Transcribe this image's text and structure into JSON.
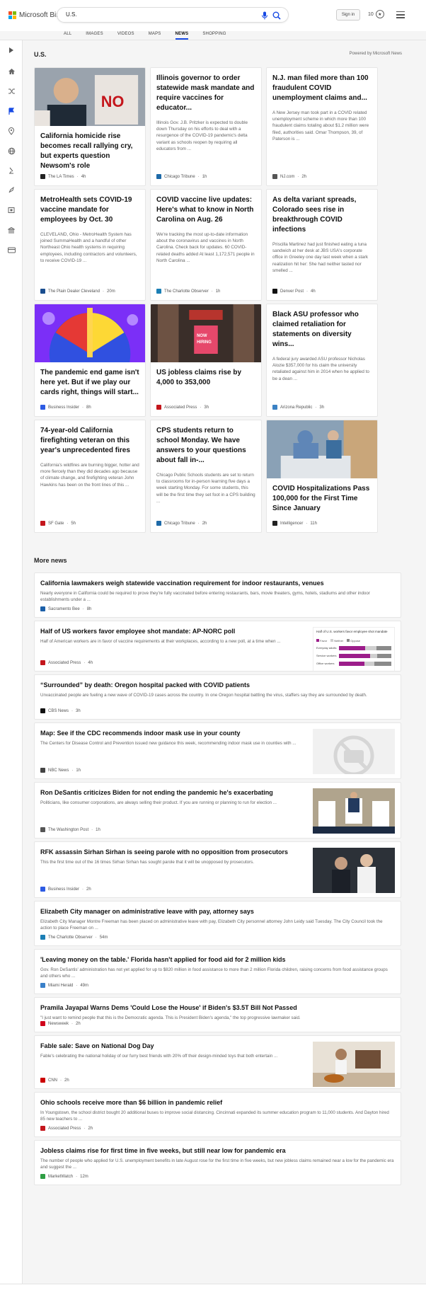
{
  "header": {
    "brand": "Microsoft Bing",
    "query": "U.S.",
    "signin_label": "Sign in",
    "reward_points": "10"
  },
  "tabs": [
    {
      "label": "ALL"
    },
    {
      "label": "IMAGES"
    },
    {
      "label": "VIDEOS"
    },
    {
      "label": "MAPS"
    },
    {
      "label": "NEWS"
    },
    {
      "label": "SHOPPING"
    }
  ],
  "active_tab": "NEWS",
  "colors": {
    "accent": "#174ae4"
  },
  "sidebar_icons": [
    "expand-icon",
    "home-icon",
    "shuffle-icon",
    "flag-icon",
    "location-icon",
    "globe-icon",
    "science-icon",
    "rocket-icon",
    "film-icon",
    "bank-icon",
    "card-icon"
  ],
  "section": {
    "title": "U.S.",
    "powered": "Powered by Microsoft News"
  },
  "cards": [
    {
      "title": "California homicide rise becomes recall rallying cry, but experts question Newsom's role",
      "snippet": "",
      "source": "The LA Times",
      "time": "4h",
      "logo_color": "#222"
    },
    {
      "title": "Illinois governor to order statewide mask mandate and require vaccines for educator...",
      "snippet": "Illinois Gov. J.B. Pritzker is expected to double down Thursday on his efforts to deal with a resurgence of the COVID-19 pandemic's delta variant as schools reopen by requiring all educators from ...",
      "source": "Chicago Tribune",
      "time": "1h",
      "logo_color": "#1e6aa8"
    },
    {
      "title": "N.J. man filed more than 100 fraudulent COVID unemployment claims and...",
      "snippet": "A New Jersey man took part in a COVID related unemployment scheme in which more than 100 fraudulent claims totaling about $1.2 million were filed, authorities said. Omar Thompson, 39, of Paterson is ...",
      "source": "NJ.com",
      "time": "2h",
      "logo_color": "#555"
    },
    {
      "title": "MetroHealth sets COVID-19 vaccine mandate for employees by Oct. 30",
      "snippet": "CLEVELAND, Ohio - MetroHealth System has joined SummaHealth and a handful of other Northeast Ohio health systems in requiring employees, including contractors and volunteers, to receive COVID-19 ...",
      "source": "The Plain Dealer Cleveland",
      "time": "20m",
      "logo_color": "#1a4e8f"
    },
    {
      "title": "COVID vaccine live updates: Here's what to know in North Carolina on Aug. 26",
      "snippet": "We're tracking the most up-to-date information about the coronavirus and vaccines in North Carolina. Check back for updates. 60 COVID-related deaths added At least 1,172,571 people in North Carolina ...",
      "source": "The Charlotte Observer",
      "time": "1h",
      "logo_color": "#1b7fb5"
    },
    {
      "title": "As delta variant spreads, Colorado sees rise in breakthrough COVID infections",
      "snippet": "Priscilla Martinez had just finished eating a tuna sandwich at her desk at JBS USA's corporate office in Greeley one day last week when a stark realization hit her: She had neither tasted nor smelled ...",
      "source": "Denver Post",
      "time": "4h",
      "logo_color": "#111"
    },
    {
      "title": "The pandemic end game isn't here yet. But if we play our cards right, things will start...",
      "snippet": "",
      "source": "Business Insider",
      "time": "8h",
      "logo_color": "#2d5be3"
    },
    {
      "title": "US jobless claims rise by 4,000 to 353,000",
      "snippet": "",
      "source": "Associated Press",
      "time": "3h",
      "logo_color": "#c4161c"
    },
    {
      "title": "Black ASU professor who claimed retaliation for statements on diversity wins...",
      "snippet": "A federal jury awarded ASU professor Nicholas Alozie $357,000 for his claim the university retaliated against him in 2014 when he applied to be a dean ...",
      "source": "Arizona Republic",
      "time": "3h",
      "logo_color": "#3b82c4"
    },
    {
      "title": "74-year-old California firefighting veteran on this year's unprecedented fires",
      "snippet": "California's wildfires are burning bigger, hotter and more fiercely than they did decades ago because of climate change, and firefighting veteran John Hawkins has been on the front lines of this ...",
      "source": "SF Gate",
      "time": "5h",
      "logo_color": "#c4161c"
    },
    {
      "title": "CPS students return to school Monday. We have answers to your questions about fall in-...",
      "snippet": "Chicago Public Schools students are set to return to classrooms for in-person learning five days a week starting Monday. For some students, this will be the first time they set foot in a CPS building ...",
      "source": "Chicago Tribune",
      "time": "2h",
      "logo_color": "#1e6aa8"
    },
    {
      "title": "COVID Hospitalizations Pass 100,000 for the First Time Since January",
      "snippet": "",
      "source": "Intelligencer",
      "time": "11h",
      "logo_color": "#222"
    }
  ],
  "more_news": {
    "title": "More news",
    "items": [
      {
        "title": "California lawmakers weigh statewide vaccination requirement for indoor restaurants, venues",
        "snippet": "Nearly everyone in California could be required to prove they're fully vaccinated before entering restaurants, bars, movie theaters, gyms, hotels, stadiums and other indoor establishments under a ...",
        "source": "Sacramento Bee",
        "time": "8h",
        "logo_color": "#1b5fa8"
      },
      {
        "title": "Half of US workers favor employee shot mandate: AP-NORC poll",
        "snippet": "Half of American workers are in favor of vaccine requirements at their workplaces, according to a new poll, at a time when ...",
        "source": "Associated Press",
        "time": "4h",
        "logo_color": "#c4161c"
      },
      {
        "title": "“Surrounded” by death: Oregon hospital packed with COVID patients",
        "snippet": "Unvaccinated people are fueling a new wave of COVID-19 cases across the country. In one Oregon hospital battling the virus, staffers say they are surrounded by death.",
        "source": "CBS News",
        "time": "3h",
        "logo_color": "#111"
      },
      {
        "title": "Map: See if the CDC recommends indoor mask use in your county",
        "snippet": "The Centers for Disease Control and Prevention issued new guidance this week, recommending indoor mask use in counties with ...",
        "source": "NBC News",
        "time": "1h",
        "logo_color": "#444"
      },
      {
        "title": "Ron DeSantis criticizes Biden for not ending the pandemic he's exacerbating",
        "snippet": "Politicians, like consumer corporations, are always selling their product. If you are running or planning to run for election ...",
        "source": "The Washington Post",
        "time": "1h",
        "logo_color": "#555"
      },
      {
        "title": "RFK assassin Sirhan Sirhan is seeing parole with no opposition from prosecutors",
        "snippet": "This the first time out of the 16 times Sirhan Sirhan has sought parole that it will be unopposed by prosecutors.",
        "source": "Business Insider",
        "time": "2h",
        "logo_color": "#2d5be3"
      },
      {
        "title": "Elizabeth City manager on administrative leave with pay, attorney says",
        "snippet": "Elizabeth City Manager Montre Freeman has been placed on administrative leave with pay, Elizabeth City personnel attorney John Leidy said Tuesday. The City Council took the action to place Freeman on ...",
        "source": "The Charlotte Observer",
        "time": "54m",
        "logo_color": "#1b7fb5"
      },
      {
        "title": "'Leaving money on the table.' Florida hasn't applied for food aid for 2 million kids",
        "snippet": "Gov. Ron DeSantis' administration has not yet applied for up to $820 million in food assistance to more than 2 million Florida children, raising concerns from food assistance groups and others who ...",
        "source": "Miami Herald",
        "time": "49m",
        "logo_color": "#3a80c9"
      },
      {
        "title": "Pramila Jayapal Warns Dems 'Could Lose the House' if Biden's $3.5T Bill Not Passed",
        "snippet": "\"I just want to remind people that this is the Democratic agenda. This is President Biden's agenda,\" the top progressive lawmaker said.",
        "source": "Newsweek",
        "time": "2h",
        "logo_color": "#d0021b"
      },
      {
        "title": "Fable sale: Save on National Dog Day",
        "snippet": "Fable's celebrating the national holiday of our furry best friends with 20% off their design-minded toys that both entertain ...",
        "source": "CNN",
        "time": "2h",
        "logo_color": "#cc0000"
      },
      {
        "title": "Ohio schools receive more than $6 billion in pandemic relief",
        "snippet": "In Youngstown, the school district bought 20 additional buses to improve social distancing. Cincinnati expanded its summer education program to 11,000 students. And Dayton hired 85 new teachers to ...",
        "source": "Associated Press",
        "time": "2h",
        "logo_color": "#c4161c"
      },
      {
        "title": "Jobless claims rise for first time in five weeks, but still near low for pandemic era",
        "snippet": "The number of people who applied for U.S. unemployment benefits in late August rose for the first time in five weeks, but new jobless claims remained near a low for the pandemic era and suggest the ...",
        "source": "MarketWatch",
        "time": "12m",
        "logo_color": "#2f9e44"
      }
    ]
  },
  "chart_thumb": {
    "caption": "Half of U.S. workers favor employee shot mandate",
    "legend": [
      "Favor",
      "Neither",
      "Oppose"
    ],
    "rows": [
      {
        "label": "Everyday adults",
        "favor": 50,
        "neither": 21,
        "oppose": 29
      },
      {
        "label": "Service workers",
        "favor": 59,
        "neither": 14,
        "oppose": 27
      },
      {
        "label": "Office workers",
        "favor": 48,
        "neither": 20,
        "oppose": 32
      }
    ]
  }
}
